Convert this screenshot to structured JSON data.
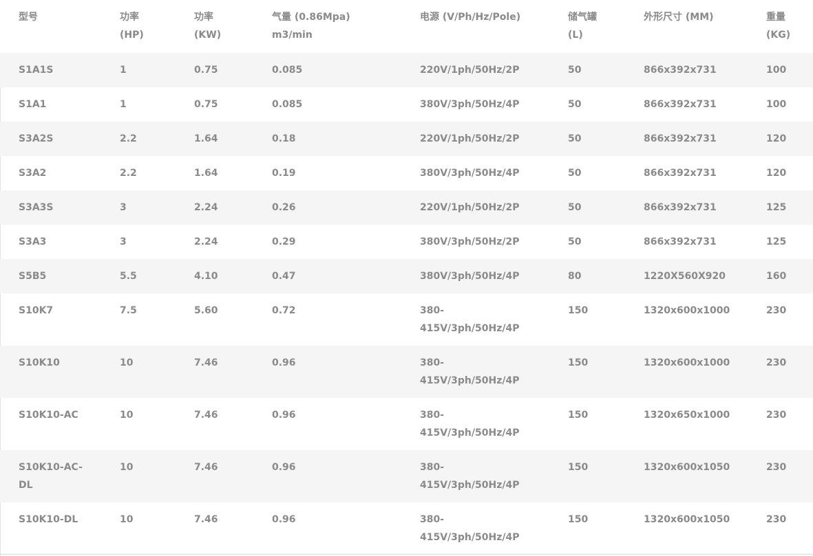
{
  "table": {
    "headers": [
      {
        "lines": [
          "型号"
        ]
      },
      {
        "lines": [
          "功率",
          "(HP)"
        ]
      },
      {
        "lines": [
          "功率",
          "(KW)"
        ]
      },
      {
        "lines": [
          "气量 (0.86Mpa)",
          "m3/min"
        ]
      },
      {
        "lines": [
          "电源 (V/Ph/Hz/Pole)"
        ]
      },
      {
        "lines": [
          "储气罐",
          "(L)"
        ]
      },
      {
        "lines": [
          "外形尺寸 (MM)"
        ]
      },
      {
        "lines": [
          "重量",
          "(KG)"
        ]
      }
    ],
    "rows": [
      {
        "cells": [
          [
            "S1A1S"
          ],
          [
            "1"
          ],
          [
            "0.75"
          ],
          [
            "0.085"
          ],
          [
            "220V/1ph/50Hz/2P"
          ],
          [
            "50"
          ],
          [
            "866x392x731"
          ],
          [
            "100"
          ]
        ]
      },
      {
        "cells": [
          [
            "S1A1"
          ],
          [
            "1"
          ],
          [
            "0.75"
          ],
          [
            "0.085"
          ],
          [
            "380V/3ph/50Hz/4P"
          ],
          [
            "50"
          ],
          [
            "866x392x731"
          ],
          [
            "100"
          ]
        ]
      },
      {
        "cells": [
          [
            "S3A2S"
          ],
          [
            "2.2"
          ],
          [
            "1.64"
          ],
          [
            "0.18"
          ],
          [
            "220V/1ph/50Hz/2P"
          ],
          [
            "50"
          ],
          [
            "866x392x731"
          ],
          [
            "120"
          ]
        ]
      },
      {
        "cells": [
          [
            "S3A2"
          ],
          [
            "2.2"
          ],
          [
            "1.64"
          ],
          [
            "0.19"
          ],
          [
            "380V/3ph/50Hz/4P"
          ],
          [
            "50"
          ],
          [
            "866x392x731"
          ],
          [
            "120"
          ]
        ]
      },
      {
        "cells": [
          [
            "S3A3S"
          ],
          [
            "3"
          ],
          [
            "2.24"
          ],
          [
            "0.26"
          ],
          [
            "220V/1ph/50Hz/2P"
          ],
          [
            "50"
          ],
          [
            "866x392x731"
          ],
          [
            "125"
          ]
        ]
      },
      {
        "cells": [
          [
            "S3A3"
          ],
          [
            "3"
          ],
          [
            "2.24"
          ],
          [
            "0.29"
          ],
          [
            "380V/3ph/50Hz/2P"
          ],
          [
            "50"
          ],
          [
            "866x392x731"
          ],
          [
            "125"
          ]
        ]
      },
      {
        "cells": [
          [
            "S5B5"
          ],
          [
            "5.5"
          ],
          [
            "4.10"
          ],
          [
            "0.47"
          ],
          [
            "380V/3ph/50Hz/4P"
          ],
          [
            "80"
          ],
          [
            "1220X560X920"
          ],
          [
            "160"
          ]
        ]
      },
      {
        "cells": [
          [
            "S10K7"
          ],
          [
            "7.5"
          ],
          [
            "5.60"
          ],
          [
            "0.72"
          ],
          [
            "380-",
            "415V/3ph/50Hz/4P"
          ],
          [
            "150"
          ],
          [
            "1320x600x1000"
          ],
          [
            "230"
          ]
        ]
      },
      {
        "cells": [
          [
            "S10K10"
          ],
          [
            "10"
          ],
          [
            "7.46"
          ],
          [
            "0.96"
          ],
          [
            "380-",
            "415V/3ph/50Hz/4P"
          ],
          [
            "150"
          ],
          [
            "1320x600x1000"
          ],
          [
            "230"
          ]
        ]
      },
      {
        "cells": [
          [
            "S10K10-AC"
          ],
          [
            "10"
          ],
          [
            "7.46"
          ],
          [
            "0.96"
          ],
          [
            "380-",
            "415V/3ph/50Hz/4P"
          ],
          [
            "150"
          ],
          [
            "1320x650x1000"
          ],
          [
            "230"
          ]
        ]
      },
      {
        "cells": [
          [
            "S10K10-AC-",
            "DL"
          ],
          [
            "10"
          ],
          [
            "7.46"
          ],
          [
            "0.96"
          ],
          [
            "380-",
            "415V/3ph/50Hz/4P"
          ],
          [
            "150"
          ],
          [
            "1320x600x1050"
          ],
          [
            "230"
          ]
        ]
      },
      {
        "cells": [
          [
            "S10K10-DL"
          ],
          [
            "10"
          ],
          [
            "7.46"
          ],
          [
            "0.96"
          ],
          [
            "380-",
            "415V/3ph/50Hz/4P"
          ],
          [
            "150"
          ],
          [
            "1320x600x1050"
          ],
          [
            "230"
          ]
        ]
      }
    ]
  }
}
